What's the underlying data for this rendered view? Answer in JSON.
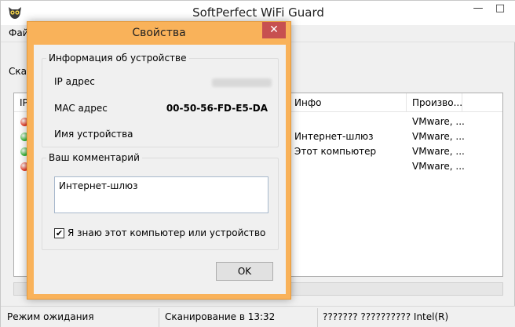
{
  "main_window": {
    "title": "SoftPerfect WiFi Guard",
    "menu_label": "Фай",
    "min_glyph": "—",
    "max_glyph": "□",
    "scan_label": "Скан"
  },
  "list": {
    "headers": {
      "col1": "IP",
      "info": "Инфо",
      "vendor": "Произво..."
    },
    "rows": [
      {
        "status_color": "#e8402a",
        "info": "",
        "vendor": "VMware, ..."
      },
      {
        "status_color": "#3cb83c",
        "info": "Интернет-шлюз",
        "vendor": "VMware, ..."
      },
      {
        "status_color": "#3cb83c",
        "info": "Этот компьютер",
        "vendor": "VMware, ..."
      },
      {
        "status_color": "#e8402a",
        "info": "",
        "vendor": "VMware, ..."
      }
    ]
  },
  "statusbar": {
    "state": "Режим ожидания",
    "scan_time": "Сканирование в 13:32",
    "adapter": "??????? ?????????? Intel(R)"
  },
  "dialog": {
    "title": "Свойства",
    "close_glyph": "✕",
    "device_info": {
      "title": "Информация об устройстве",
      "ip_label": "IP адрес",
      "mac_label": "MAC адрес",
      "mac_value": "00-50-56-FD-E5-DA",
      "name_label": "Имя устройства"
    },
    "comment": {
      "title": "Ваш комментарий",
      "value": "Интернет-шлюз",
      "known_checked": true,
      "known_label": "Я знаю этот компьютер или устройство"
    },
    "ok_label": "OK"
  }
}
